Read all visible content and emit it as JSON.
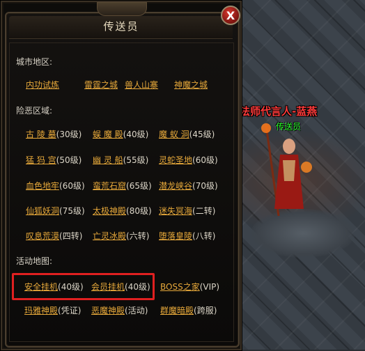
{
  "panel": {
    "title": "传送员",
    "close_label": "X"
  },
  "npc": {
    "name": "法师代言人-蓝燕",
    "role": "传送员"
  },
  "sections": {
    "city": "城市地区:",
    "danger": "险恶区域:",
    "event": "活动地图:"
  },
  "city_maps": [
    "内功试炼",
    "雷霆之城",
    "兽人山寨",
    "神魔之城"
  ],
  "danger_maps": [
    {
      "name": "古 陵 墓",
      "level": "(30级)"
    },
    {
      "name": "蜈 魔 殿",
      "level": "(40级)"
    },
    {
      "name": "魔 蚁 洞",
      "level": "(45级)"
    },
    {
      "name": "猛 犸 宫",
      "level": "(50级)"
    },
    {
      "name": "幽 灵 船",
      "level": "(55级)"
    },
    {
      "name": "灵蛇圣地",
      "level": "(60级)"
    },
    {
      "name": "血色地牢",
      "level": "(60级)"
    },
    {
      "name": "蛮荒石窟",
      "level": "(65级)"
    },
    {
      "name": "潜龙峡谷",
      "level": "(70级)"
    },
    {
      "name": "仙狐妖洞",
      "level": "(75级)"
    },
    {
      "name": "太极神殿",
      "level": "(80级)"
    },
    {
      "name": "迷失冥海",
      "level": "(二转)"
    },
    {
      "name": "叹息荒漠",
      "level": "(四转)"
    },
    {
      "name": "亡灵冰殿",
      "level": "(六转)"
    },
    {
      "name": "堕落皇陵",
      "level": "(八转)"
    }
  ],
  "event_maps": [
    {
      "name": "安全挂机",
      "level": "(40级)"
    },
    {
      "name": "会员挂机",
      "level": "(40级)"
    },
    {
      "name": "BOSS之家",
      "level": "(VIP)"
    },
    {
      "name": "玛雅神殿",
      "level": "(凭证)"
    },
    {
      "name": "恶魔神殿",
      "level": "(活动)"
    },
    {
      "name": "群魔暗殿",
      "level": "(跨服)"
    }
  ],
  "colors": {
    "link": "#e6a83a",
    "highlight": "#e02020",
    "npc_name": "#ff3a3a",
    "npc_role": "#2aff2a"
  }
}
